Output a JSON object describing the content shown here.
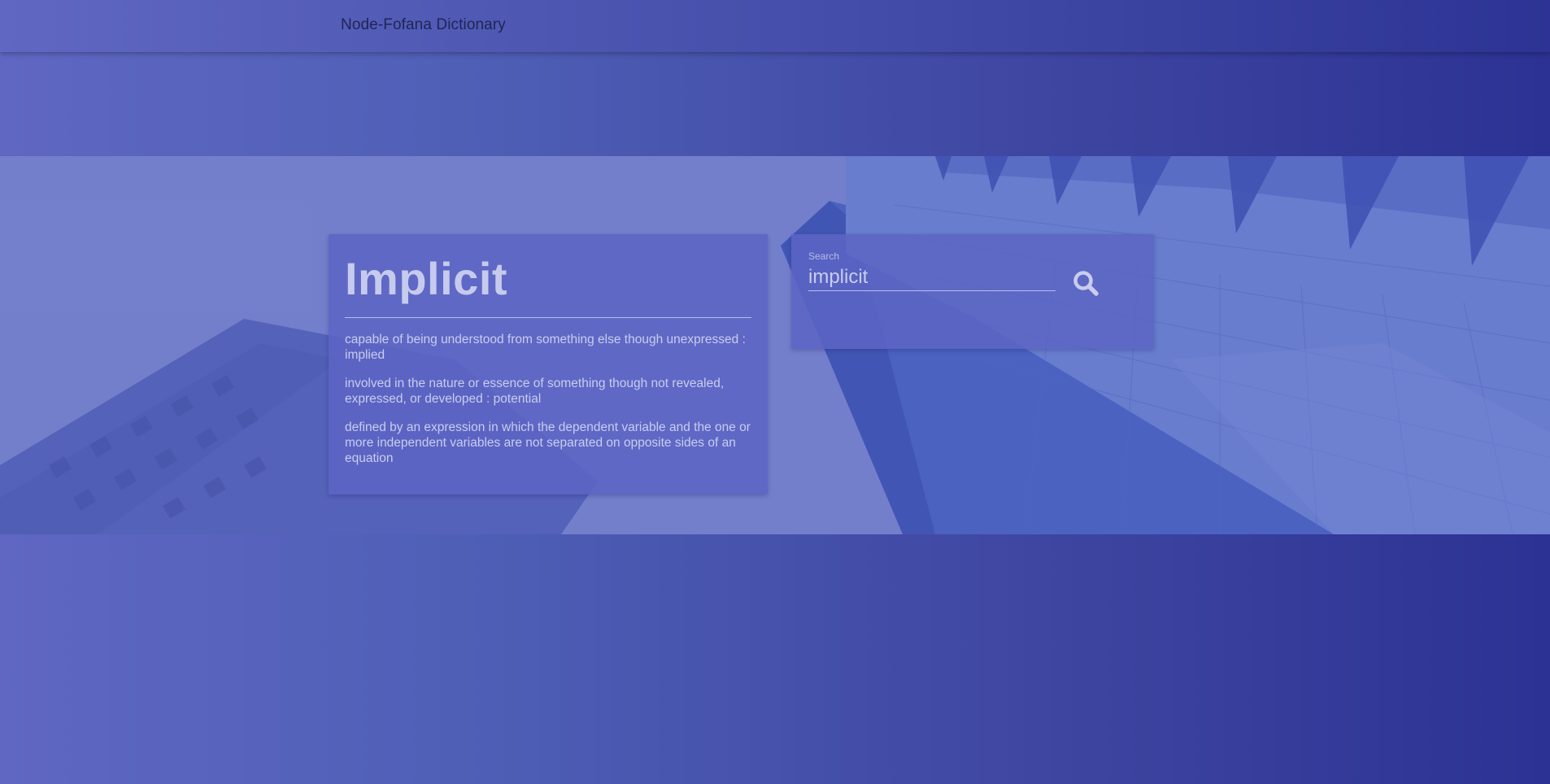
{
  "navbar": {
    "brand": "Node-Fofana Dictionary"
  },
  "definition": {
    "word": "Implicit",
    "meanings": [
      "capable of being understood from something else though unexpressed : implied",
      "involved in the nature or essence of something though not revealed, expressed, or developed : potential",
      "defined by an expression in which the dependent variable and the one or more independent variables are not separated on opposite sides of an equation"
    ]
  },
  "search": {
    "label": "Search",
    "value": "implicit",
    "icon": "search-icon"
  },
  "colors": {
    "accent_dark": "#2b3293",
    "accent_light": "#5f67c2",
    "text_light": "#c9cdee"
  }
}
